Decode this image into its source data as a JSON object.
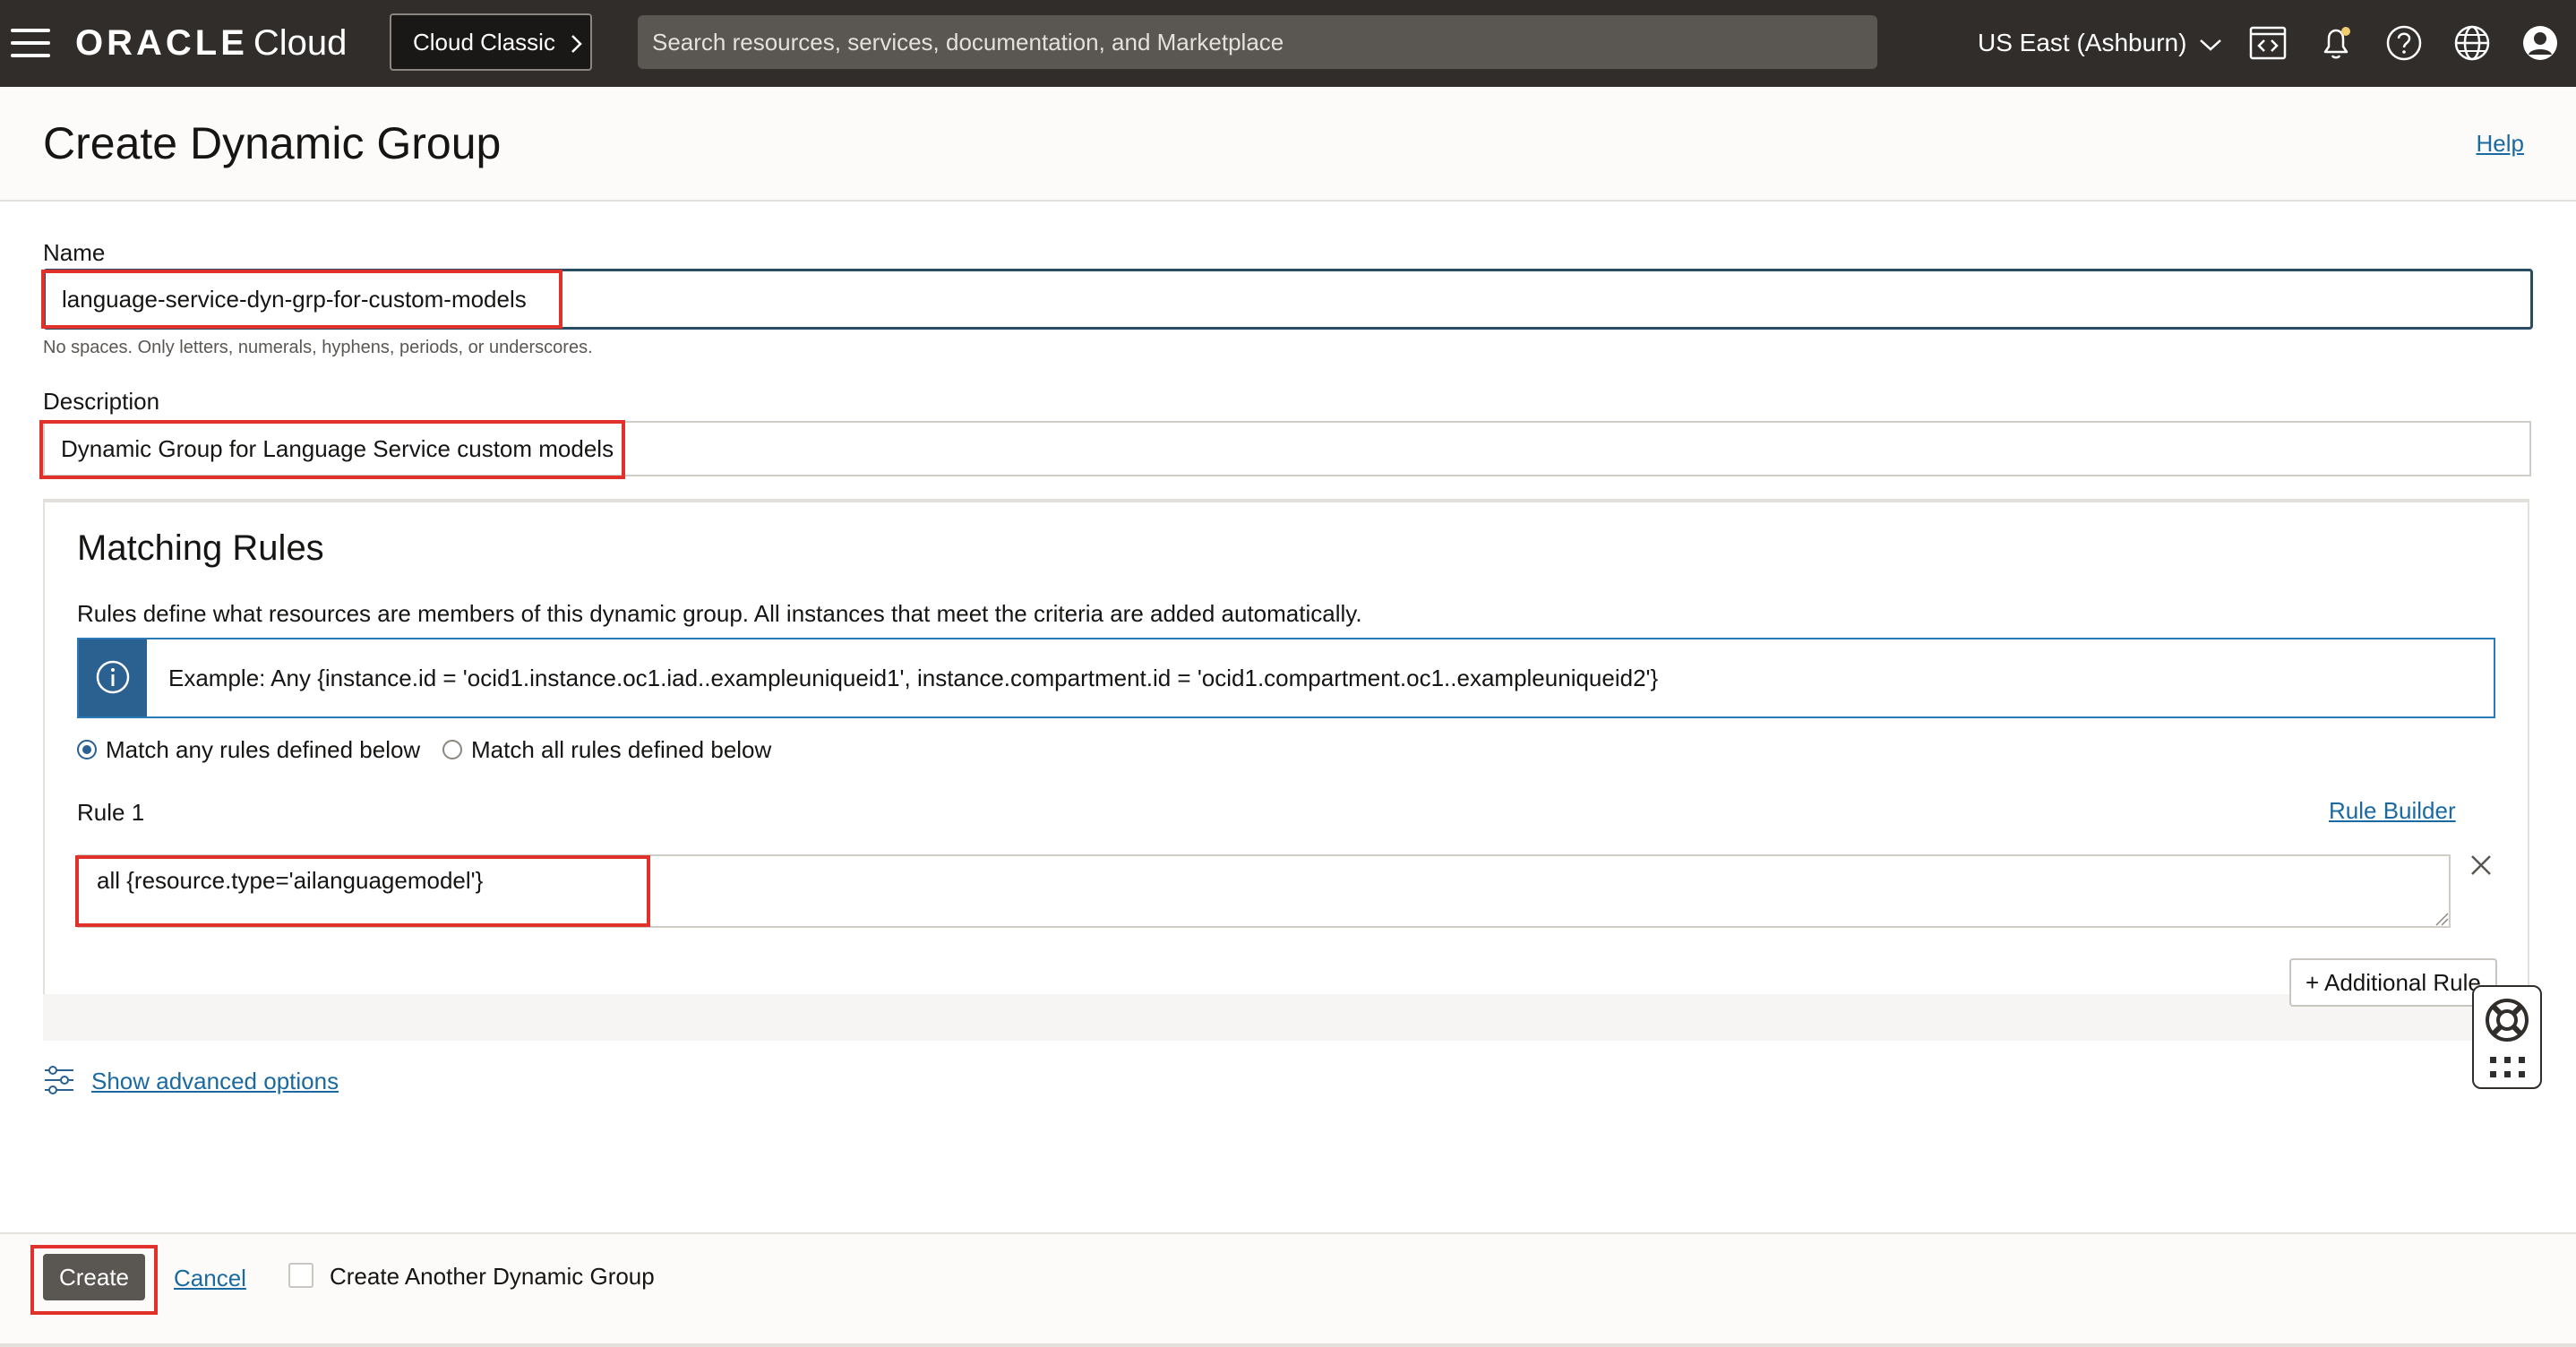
{
  "topbar": {
    "brand": "ORACLE",
    "product": "Cloud",
    "classic_button": "Cloud Classic",
    "search_placeholder": "Search resources, services, documentation, and Marketplace",
    "region": "US East (Ashburn)",
    "icons": [
      "menu-icon",
      "code-editor-icon",
      "bell-icon",
      "help-icon",
      "globe-icon",
      "profile-icon"
    ]
  },
  "header": {
    "title": "Create Dynamic Group",
    "help_link": "Help"
  },
  "form": {
    "name_label": "Name",
    "name_value": "language-service-dyn-grp-for-custom-models",
    "name_hint": "No spaces. Only letters, numerals, hyphens, periods, or underscores.",
    "description_label": "Description",
    "description_value": "Dynamic Group for Language Service custom models"
  },
  "matching_rules": {
    "title": "Matching Rules",
    "description": "Rules define what resources are members of this dynamic group. All instances that meet the criteria are added automatically.",
    "example": "Example: Any {instance.id = 'ocid1.instance.oc1.iad..exampleuniqueid1', instance.compartment.id = 'ocid1.compartment.oc1..exampleuniqueid2'}",
    "match_options": [
      {
        "label": "Match any rules defined below",
        "selected": true
      },
      {
        "label": "Match all rules defined below",
        "selected": false
      }
    ],
    "rule_label": "Rule 1",
    "rule_builder": "Rule Builder",
    "rule_value": "all {resource.type='ailanguagemodel'}",
    "additional_rule": "+ Additional Rule"
  },
  "advanced": {
    "label": "Show advanced options"
  },
  "footer": {
    "create_button": "Create",
    "cancel_link": "Cancel",
    "create_another_label": "Create Another Dynamic Group",
    "create_another_checked": false
  },
  "colors": {
    "topbar_bg": "#312d2a",
    "link": "#1a6aa1",
    "info_accent": "#2a6190",
    "highlight": "#e0322b",
    "primary_button": "#5a5652"
  }
}
